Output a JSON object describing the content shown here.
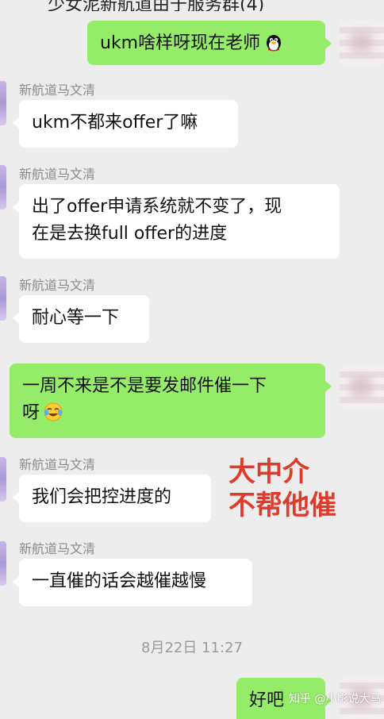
{
  "header": {
    "title_partial": "少女泥新航道由于服务群(4)"
  },
  "messages": [
    {
      "side": "out",
      "text": "ukm啥样呀现在老师",
      "emoji": "penguin-emoji"
    },
    {
      "side": "in",
      "sender": "新航道马文清",
      "text": "ukm不都来offer了嘛"
    },
    {
      "side": "in",
      "sender": "新航道马文清",
      "line1": "出了offer申请系统就不变了，现",
      "line2": "在是去换full offer的进度"
    },
    {
      "side": "in",
      "sender": "新航道马文清",
      "text": "耐心等一下"
    },
    {
      "side": "out",
      "line1": "一周不来是不是要发邮件催一下",
      "line2": "呀",
      "emoji": "crying-laughing-emoji"
    },
    {
      "side": "in",
      "sender": "新航道马文清",
      "text": "我们会把控进度的"
    },
    {
      "side": "in",
      "sender": "新航道马文清",
      "text": "一直催的话会越催越慢"
    },
    {
      "side": "out",
      "text": "好吧"
    }
  ],
  "annotation": {
    "line1": "大中介",
    "line2": "不帮他催",
    "color": "#e03a2a"
  },
  "timestamp": "8月22日 11:27",
  "watermark": "知乎 @小影说大马",
  "colors": {
    "background": "#ededed",
    "bubble_out": "#95ec69",
    "bubble_in": "#ffffff",
    "sender": "#8a8a8a"
  }
}
